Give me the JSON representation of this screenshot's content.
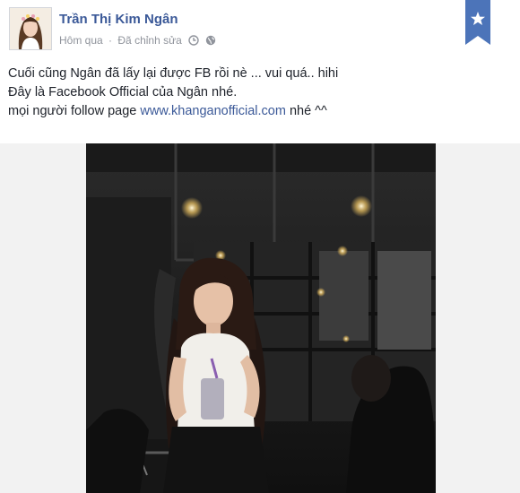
{
  "post": {
    "author": "Trần Thị Kim Ngân",
    "time": "Hôm qua",
    "separator": "·",
    "edited": "Đã chỉnh sửa",
    "icons": {
      "clock": "clock-icon",
      "globe": "globe-icon",
      "bookmark": "star-bookmark-icon"
    },
    "lines": [
      "Cuối cũng Ngân đã lấy lại được FB rồi nè ... vui quá.. hihi",
      "Đây là Facebook Official của Ngân nhé."
    ],
    "line3_prefix": "mọi người follow page ",
    "link": "www.khanganofficial.com",
    "line3_suffix": " nhé ^^"
  },
  "colors": {
    "link": "#3b5998",
    "text": "#1d2129",
    "meta": "#90949c",
    "bookmark": "#4c74b9"
  }
}
